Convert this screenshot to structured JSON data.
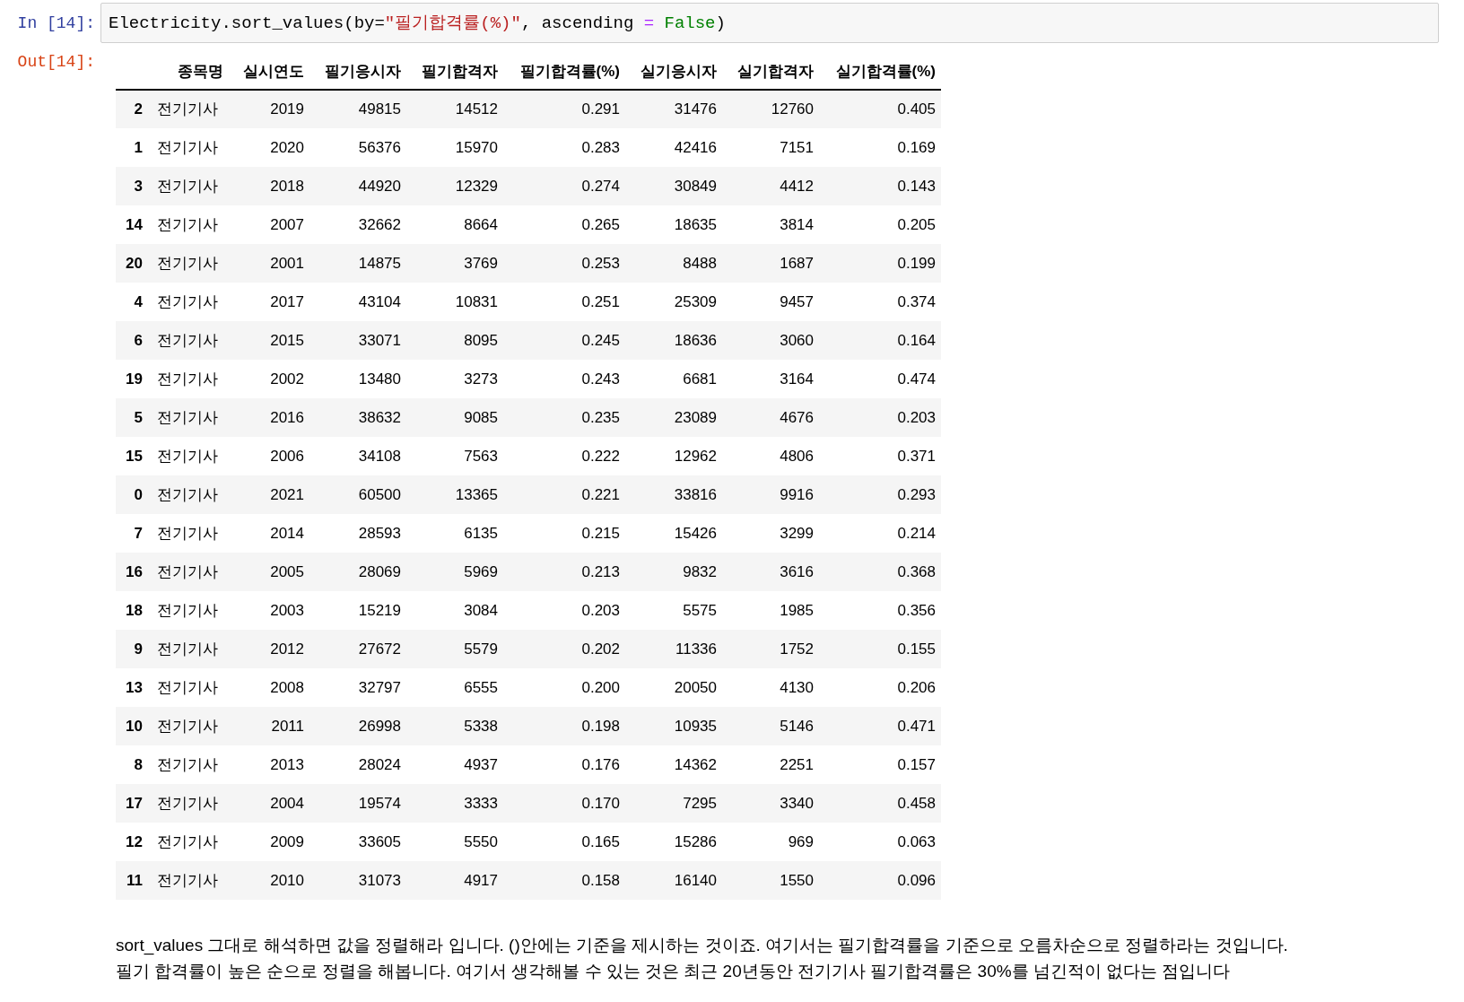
{
  "input_cell": {
    "prompt": "In [14]:",
    "code": [
      {
        "kind": "plain",
        "text": "Electricity.sort_values(by="
      },
      {
        "kind": "string",
        "text": "\"필기합격률(%)\""
      },
      {
        "kind": "plain",
        "text": ", ascending "
      },
      {
        "kind": "operator",
        "text": "= "
      },
      {
        "kind": "keyword",
        "text": "False"
      },
      {
        "kind": "plain",
        "text": ")"
      }
    ]
  },
  "output_cell": {
    "prompt": "Out[14]:",
    "table": {
      "columns": [
        "",
        "종목명",
        "실시연도",
        "필기응시자",
        "필기합격자",
        "필기합격률(%)",
        "실기응시자",
        "실기합격자",
        "실기합격률(%)"
      ],
      "rows": [
        [
          "2",
          "전기기사",
          "2019",
          "49815",
          "14512",
          "0.291",
          "31476",
          "12760",
          "0.405"
        ],
        [
          "1",
          "전기기사",
          "2020",
          "56376",
          "15970",
          "0.283",
          "42416",
          "7151",
          "0.169"
        ],
        [
          "3",
          "전기기사",
          "2018",
          "44920",
          "12329",
          "0.274",
          "30849",
          "4412",
          "0.143"
        ],
        [
          "14",
          "전기기사",
          "2007",
          "32662",
          "8664",
          "0.265",
          "18635",
          "3814",
          "0.205"
        ],
        [
          "20",
          "전기기사",
          "2001",
          "14875",
          "3769",
          "0.253",
          "8488",
          "1687",
          "0.199"
        ],
        [
          "4",
          "전기기사",
          "2017",
          "43104",
          "10831",
          "0.251",
          "25309",
          "9457",
          "0.374"
        ],
        [
          "6",
          "전기기사",
          "2015",
          "33071",
          "8095",
          "0.245",
          "18636",
          "3060",
          "0.164"
        ],
        [
          "19",
          "전기기사",
          "2002",
          "13480",
          "3273",
          "0.243",
          "6681",
          "3164",
          "0.474"
        ],
        [
          "5",
          "전기기사",
          "2016",
          "38632",
          "9085",
          "0.235",
          "23089",
          "4676",
          "0.203"
        ],
        [
          "15",
          "전기기사",
          "2006",
          "34108",
          "7563",
          "0.222",
          "12962",
          "4806",
          "0.371"
        ],
        [
          "0",
          "전기기사",
          "2021",
          "60500",
          "13365",
          "0.221",
          "33816",
          "9916",
          "0.293"
        ],
        [
          "7",
          "전기기사",
          "2014",
          "28593",
          "6135",
          "0.215",
          "15426",
          "3299",
          "0.214"
        ],
        [
          "16",
          "전기기사",
          "2005",
          "28069",
          "5969",
          "0.213",
          "9832",
          "3616",
          "0.368"
        ],
        [
          "18",
          "전기기사",
          "2003",
          "15219",
          "3084",
          "0.203",
          "5575",
          "1985",
          "0.356"
        ],
        [
          "9",
          "전기기사",
          "2012",
          "27672",
          "5579",
          "0.202",
          "11336",
          "1752",
          "0.155"
        ],
        [
          "13",
          "전기기사",
          "2008",
          "32797",
          "6555",
          "0.200",
          "20050",
          "4130",
          "0.206"
        ],
        [
          "10",
          "전기기사",
          "2011",
          "26998",
          "5338",
          "0.198",
          "10935",
          "5146",
          "0.471"
        ],
        [
          "8",
          "전기기사",
          "2013",
          "28024",
          "4937",
          "0.176",
          "14362",
          "2251",
          "0.157"
        ],
        [
          "17",
          "전기기사",
          "2004",
          "19574",
          "3333",
          "0.170",
          "7295",
          "3340",
          "0.458"
        ],
        [
          "12",
          "전기기사",
          "2009",
          "33605",
          "5550",
          "0.165",
          "15286",
          "969",
          "0.063"
        ],
        [
          "11",
          "전기기사",
          "2010",
          "31073",
          "4917",
          "0.158",
          "16140",
          "1550",
          "0.096"
        ]
      ]
    }
  },
  "markdown": [
    "sort_values 그대로 해석하면 값을 정렬해라 입니다. ()안에는 기준을 제시하는 것이죠. 여기서는 필기합격률을 기준으로 오름차순으로 정렬하라는 것입니다.",
    "필기 합격률이 높은 순으로 정렬을 해봅니다. 여기서 생각해볼 수 있는 것은 최근 20년동안 전기기사 필기합격률은 30%를 넘긴적이 없다는 점입니다"
  ]
}
